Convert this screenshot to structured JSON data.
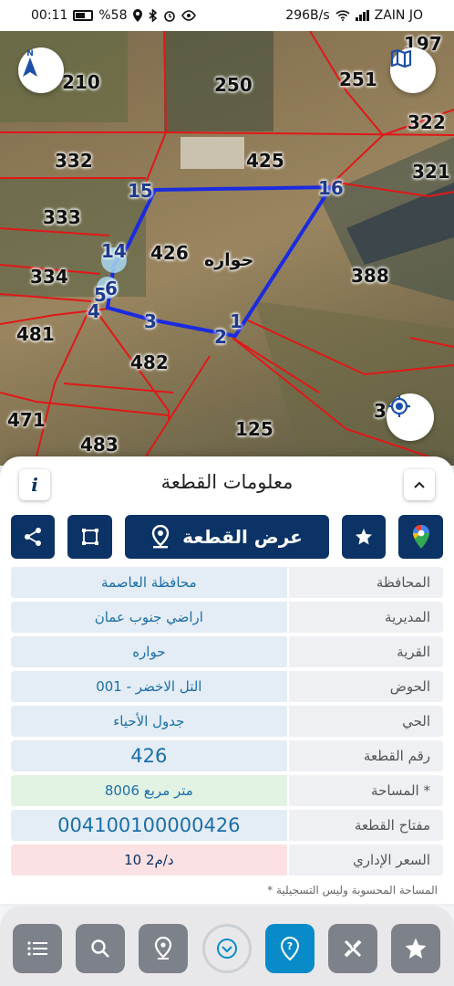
{
  "status_bar": {
    "time": "00:11",
    "battery": "%58",
    "speed": "296B/s",
    "carrier": "ZAIN JO"
  },
  "map": {
    "parcel_numbers": [
      "197",
      "210",
      "250",
      "251",
      "322",
      "332",
      "425",
      "321",
      "333",
      "426",
      "334",
      "388",
      "481",
      "482",
      "471",
      "483",
      "125",
      "3"
    ],
    "village_label": "حواره",
    "vertex_numbers": [
      "15",
      "16",
      "14",
      "5",
      "6",
      "4",
      "3",
      "2",
      "1"
    ],
    "icons": [
      "north-compass-icon",
      "map-layers-icon",
      "my-location-icon"
    ]
  },
  "panel": {
    "title": "معلومات القطعة",
    "info_icon": "i",
    "show_parcel_label": "عرض القطعة",
    "rows": [
      {
        "label": "المحافظة",
        "value": "محافظة العاصمة"
      },
      {
        "label": "المديرية",
        "value": "اراضي جنوب عمان"
      },
      {
        "label": "القرية",
        "value": "حواره"
      },
      {
        "label": "الحوض",
        "value": "التل الاخضر - 001"
      },
      {
        "label": "الحي",
        "value": "جدول الأحياء"
      },
      {
        "label": "رقم القطعة",
        "value": "426"
      },
      {
        "label": "المساحة *",
        "value": "8006  متر مربع"
      },
      {
        "label": "مفتاح القطعة",
        "value": "004100100000426"
      },
      {
        "label": "السعر الإداري",
        "value": "10 د/م2"
      }
    ],
    "footnote": "* المساحة المحسوبة وليس التسجيلية"
  },
  "colors": {
    "navy": "#0c3366",
    "accent_blue": "#0a8bc9",
    "value_text": "#1b6fa8",
    "area_bg": "#e3f3e3",
    "price_bg": "#fbe1e3",
    "parcel_line": "#e01818",
    "selected_parcel_line": "#1a2be0"
  }
}
